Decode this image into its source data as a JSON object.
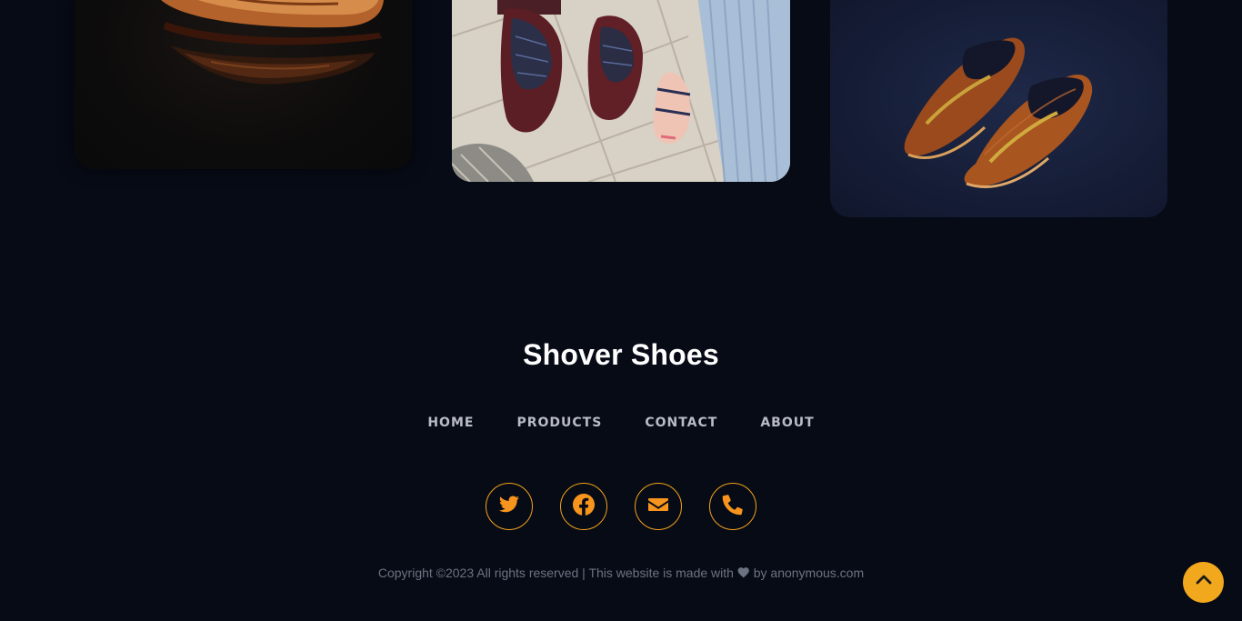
{
  "gallery": {
    "images": [
      {
        "alt": "tooled-leather-oxford-shoe"
      },
      {
        "alt": "two-tone-oxford-shoes-on-tiles"
      },
      {
        "alt": "brown-horsebit-loafers"
      }
    ]
  },
  "footer": {
    "brand": "Shover Shoes",
    "nav": [
      "HOME",
      "PRODUCTS",
      "CONTACT",
      "ABOUT"
    ],
    "social": [
      {
        "icon": "twitter-icon"
      },
      {
        "icon": "facebook-icon"
      },
      {
        "icon": "envelope-icon"
      },
      {
        "icon": "phone-icon"
      }
    ],
    "copyright_prefix": "Copyright ©2023 All rights reserved | This website is made with",
    "copyright_suffix": "by anonymous.com"
  },
  "colors": {
    "background": "#070b16",
    "accent": "#f7941d",
    "back_to_top": "#f2a81d"
  }
}
